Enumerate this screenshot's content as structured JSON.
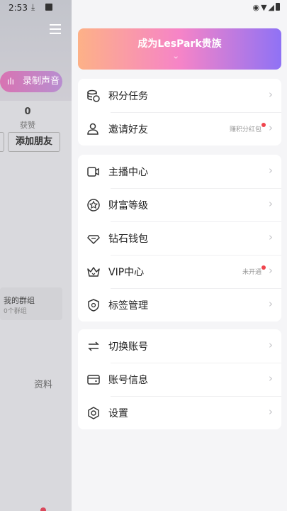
{
  "status_bar": {
    "time": "2:53"
  },
  "background_app": {
    "record_button": "录制声音",
    "likes_count": "0",
    "likes_label": "获赞",
    "add_friend_button": "添加朋友",
    "group_title": "我的群组",
    "group_count": "0个群组",
    "profile_tab": "资料"
  },
  "drawer": {
    "banner_title": "成为LesPark贵族",
    "sections": [
      {
        "items": [
          {
            "label": "积分任务",
            "icon": "points-icon"
          },
          {
            "label": "邀请好友",
            "icon": "invite-friends-icon",
            "hint": "赚积分红包",
            "dot": true
          }
        ]
      },
      {
        "items": [
          {
            "label": "主播中心",
            "icon": "host-center-icon"
          },
          {
            "label": "财富等级",
            "icon": "wealth-level-icon"
          },
          {
            "label": "钻石钱包",
            "icon": "diamond-wallet-icon"
          },
          {
            "label": "VIP中心",
            "icon": "vip-crown-icon",
            "hint": "未开通",
            "dot": true
          },
          {
            "label": "标签管理",
            "icon": "tag-manage-icon"
          }
        ]
      },
      {
        "items": [
          {
            "label": "切换账号",
            "icon": "switch-account-icon"
          },
          {
            "label": "账号信息",
            "icon": "account-info-icon"
          },
          {
            "label": "设置",
            "icon": "settings-icon"
          }
        ]
      }
    ]
  },
  "colors": {
    "banner_start": "#fdb187",
    "banner_mid": "#f684c7",
    "banner_end": "#8f72f5",
    "notification_dot": "#f0444d"
  }
}
